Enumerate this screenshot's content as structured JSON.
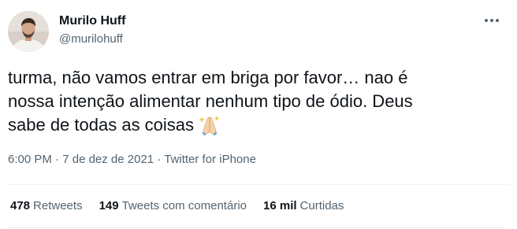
{
  "author": {
    "name": "Murilo Huff",
    "handle": "@murilohuff",
    "avatar_icon": "profile-photo"
  },
  "more_icon": "ellipsis-horizontal-icon",
  "tweet": {
    "line1": "turma, não vamos entrar em briga por favor… nao é",
    "line2": "nossa intenção alimentar nenhum tipo de ódio. Deus",
    "line3": "sabe de todas as coisas",
    "emoji": "folded-hands-icon"
  },
  "meta": {
    "time": "6:00 PM",
    "separator1": " · ",
    "date": "7 de dez de 2021",
    "separator2": " · ",
    "source": "Twitter for iPhone"
  },
  "stats": {
    "retweets_count": "478",
    "retweets_label": "Retweets",
    "quotes_count": "149",
    "quotes_label": "Tweets com comentário",
    "likes_count": "16 mil",
    "likes_label": "Curtidas"
  },
  "colors": {
    "text_primary": "#0f1419",
    "text_secondary": "#536471",
    "divider": "#eff3f4"
  }
}
